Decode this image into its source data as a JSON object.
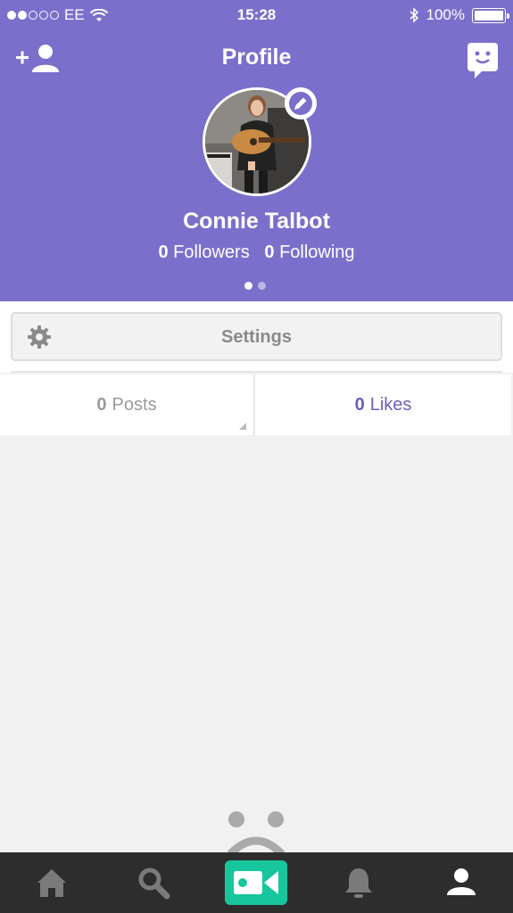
{
  "status_bar": {
    "carrier": "EE",
    "time": "15:28",
    "battery": "100%"
  },
  "header": {
    "title": "Profile"
  },
  "profile": {
    "name": "Connie Talbot",
    "followers_count": "0",
    "followers_label": "Followers",
    "following_count": "0",
    "following_label": "Following"
  },
  "settings": {
    "label": "Settings"
  },
  "tabs": [
    {
      "count": "0",
      "label": "Posts"
    },
    {
      "count": "0",
      "label": "Likes"
    }
  ],
  "colors": {
    "header_bg": "#7b6fcc",
    "accent": "#6a5fb8",
    "record_green": "#17c69c",
    "tabbar_bg": "#2d2d2d"
  },
  "icons": [
    "add-user-icon",
    "chat-face-icon",
    "pencil-icon",
    "gear-icon",
    "home-icon",
    "search-icon",
    "video-camera-icon",
    "bell-icon",
    "profile-icon",
    "sad-face-icon"
  ]
}
